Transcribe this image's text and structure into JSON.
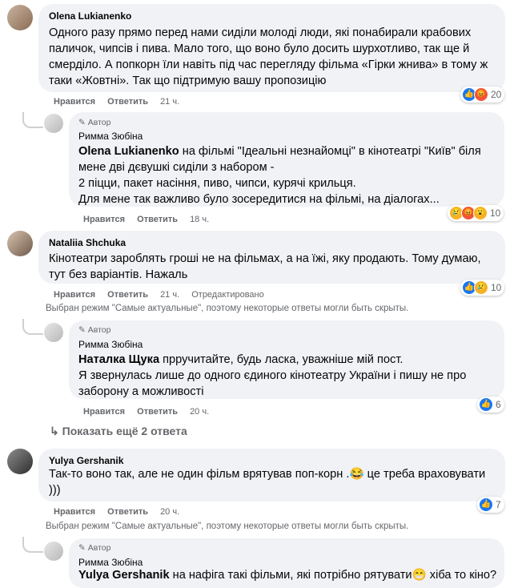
{
  "comments": [
    {
      "author": "Olena Lukianenko",
      "text": "Одного разу прямо перед нами сиділи молоді люди, які понабирали крабових паличок, чипсів і пива. Мало того, що воно було досить шурхотливо, так ще й смерділо. А попкорн їли навіть під час перегляду фільма «Гірки жнива» в тому ж таки «Жовтні». Так що підтримую вашу пропозицію",
      "like_label": "Нравится",
      "reply_label": "Ответить",
      "time": "21 ч.",
      "reaction_count": "20"
    },
    {
      "author_badge": "Автор",
      "author": "Римма Зюбіна",
      "mention": "Olena Lukianenko",
      "text": " на фільмі \"Ідеальні незнайомці\" в кінотеатрі \"Київ\" біля мене дві дєвушкі сиділи з набором -\n2 піцци, пакет насіння, пиво, чипси, курячі крильця.\nДля мене так важливо було зосередитися на фільмі, на діалогах...",
      "like_label": "Нравится",
      "reply_label": "Ответить",
      "time": "18 ч.",
      "reaction_count": "10"
    },
    {
      "author": "Nataliia Shchuka",
      "text": "Кінотеатри зароблять гроші не на фільмах, а на їжі, яку продають. Тому думаю, тут без варіантів. Нажаль",
      "like_label": "Нравится",
      "reply_label": "Ответить",
      "time": "21 ч.",
      "edited": "Отредактировано",
      "reaction_count": "10"
    },
    {
      "author_badge": "Автор",
      "author": "Римма Зюбіна",
      "mention": "Наталка Щука",
      "text": " прручитайте, будь ласка, уважніше мій пост.\nЯ звернулась лише до одного єдиного кінотеатру України і пишу не про заборону а можливості",
      "like_label": "Нравится",
      "reply_label": "Ответить",
      "time": "20 ч.",
      "reaction_count": "6"
    },
    {
      "author": "Yulya Gershanik",
      "text": "Так-то воно так, але не один фільм врятував поп-корн .",
      "text_tail": " це треба враховувати )))",
      "like_label": "Нравится",
      "reply_label": "Ответить",
      "time": "20 ч.",
      "reaction_count": "7"
    },
    {
      "author_badge": "Автор",
      "author": "Римма Зюбіна",
      "mention": "Yulya Gershanik",
      "text": " на нафіга такі фільми, які потрібно рятувати",
      "text_tail": " хіба то кіно?"
    }
  ],
  "notice": "Выбран режим \"Самые актуальные\", поэтому некоторые ответы могли быть скрыты.",
  "show_more": "Показать ещё 2 ответа"
}
